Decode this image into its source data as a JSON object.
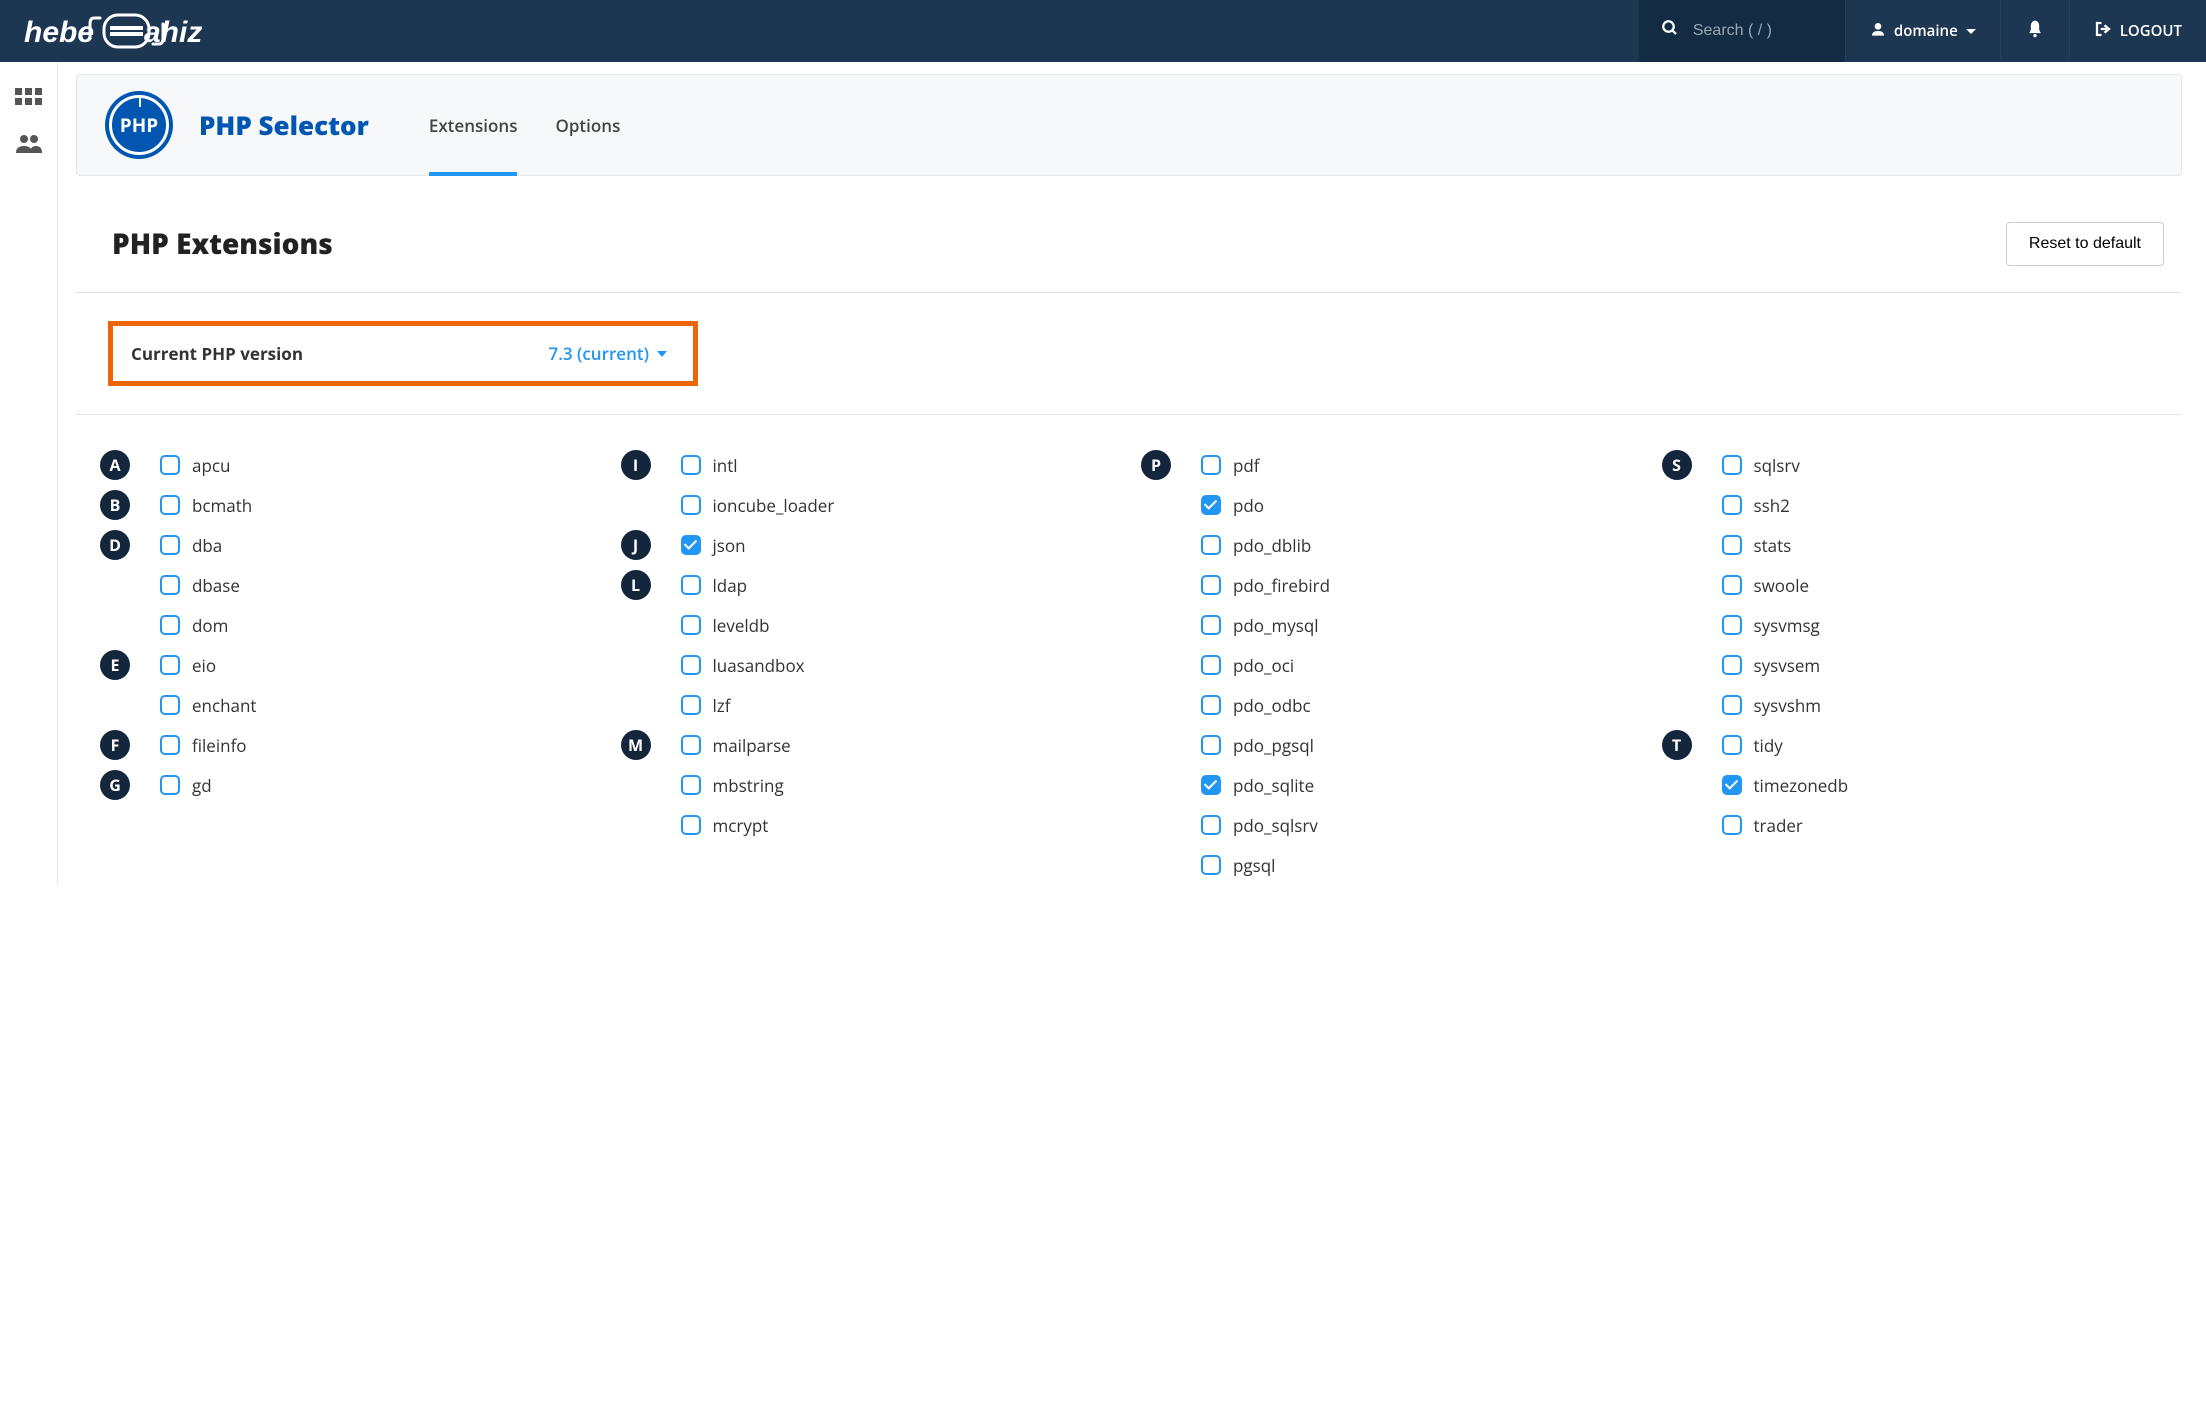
{
  "header": {
    "search_placeholder": "Search ( / )",
    "user_label": "domaine",
    "logout_label": "LOGOUT"
  },
  "page": {
    "title": "PHP Selector",
    "tabs": [
      {
        "label": "Extensions",
        "active": true
      },
      {
        "label": "Options",
        "active": false
      }
    ]
  },
  "section": {
    "title": "PHP Extensions",
    "reset_label": "Reset to default"
  },
  "version": {
    "label": "Current PHP version",
    "value": "7.3 (current)"
  },
  "columns": [
    [
      {
        "letter": "A",
        "items": [
          {
            "name": "apcu",
            "checked": false
          }
        ]
      },
      {
        "letter": "B",
        "items": [
          {
            "name": "bcmath",
            "checked": false
          }
        ]
      },
      {
        "letter": "D",
        "items": [
          {
            "name": "dba",
            "checked": false
          },
          {
            "name": "dbase",
            "checked": false
          },
          {
            "name": "dom",
            "checked": false
          }
        ]
      },
      {
        "letter": "E",
        "items": [
          {
            "name": "eio",
            "checked": false
          },
          {
            "name": "enchant",
            "checked": false
          }
        ]
      },
      {
        "letter": "F",
        "items": [
          {
            "name": "fileinfo",
            "checked": false
          }
        ]
      },
      {
        "letter": "G",
        "items": [
          {
            "name": "gd",
            "checked": false
          }
        ]
      }
    ],
    [
      {
        "letter": "I",
        "items": [
          {
            "name": "intl",
            "checked": false
          },
          {
            "name": "ioncube_loader",
            "checked": false
          }
        ]
      },
      {
        "letter": "J",
        "items": [
          {
            "name": "json",
            "checked": true
          }
        ]
      },
      {
        "letter": "L",
        "items": [
          {
            "name": "ldap",
            "checked": false
          },
          {
            "name": "leveldb",
            "checked": false
          },
          {
            "name": "luasandbox",
            "checked": false
          },
          {
            "name": "lzf",
            "checked": false
          }
        ]
      },
      {
        "letter": "M",
        "items": [
          {
            "name": "mailparse",
            "checked": false
          },
          {
            "name": "mbstring",
            "checked": false
          },
          {
            "name": "mcrypt",
            "checked": false
          }
        ]
      }
    ],
    [
      {
        "letter": "P",
        "items": [
          {
            "name": "pdf",
            "checked": false
          },
          {
            "name": "pdo",
            "checked": true
          },
          {
            "name": "pdo_dblib",
            "checked": false
          },
          {
            "name": "pdo_firebird",
            "checked": false
          },
          {
            "name": "pdo_mysql",
            "checked": false
          },
          {
            "name": "pdo_oci",
            "checked": false
          },
          {
            "name": "pdo_odbc",
            "checked": false
          },
          {
            "name": "pdo_pgsql",
            "checked": false
          },
          {
            "name": "pdo_sqlite",
            "checked": true
          },
          {
            "name": "pdo_sqlsrv",
            "checked": false
          },
          {
            "name": "pgsql",
            "checked": false
          }
        ]
      }
    ],
    [
      {
        "letter": "S",
        "items": [
          {
            "name": "sqlsrv",
            "checked": false
          },
          {
            "name": "ssh2",
            "checked": false
          },
          {
            "name": "stats",
            "checked": false
          },
          {
            "name": "swoole",
            "checked": false
          },
          {
            "name": "sysvmsg",
            "checked": false
          },
          {
            "name": "sysvsem",
            "checked": false
          },
          {
            "name": "sysvshm",
            "checked": false
          }
        ]
      },
      {
        "letter": "T",
        "items": [
          {
            "name": "tidy",
            "checked": false
          },
          {
            "name": "timezonedb",
            "checked": true
          },
          {
            "name": "trader",
            "checked": false
          }
        ]
      }
    ]
  ]
}
